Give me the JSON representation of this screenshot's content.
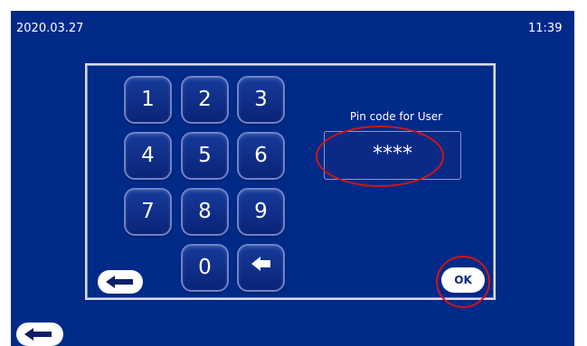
{
  "status_bar": {
    "date": "2020.03.27",
    "time": "11:39"
  },
  "keypad": {
    "keys": [
      "1",
      "2",
      "3",
      "4",
      "5",
      "6",
      "7",
      "8",
      "9",
      "0"
    ]
  },
  "pin": {
    "label": "Pin code for User",
    "value": "****"
  },
  "ok_label": "OK",
  "icons": {
    "back": "back-arrow-icon",
    "backspace": "backspace-arrow-icon"
  },
  "colors": {
    "screen_background": "#002A88",
    "highlight_ring": "#D21414"
  }
}
